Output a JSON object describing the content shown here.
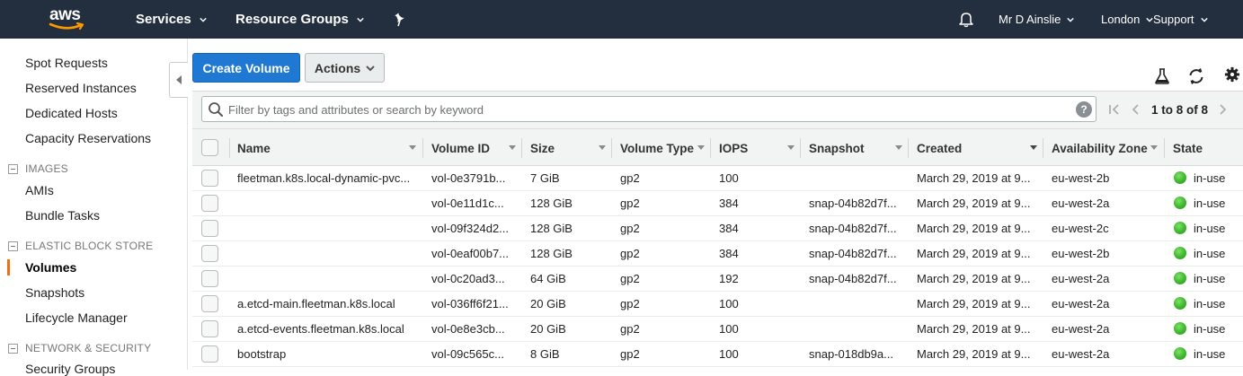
{
  "nav": {
    "logo": "aws",
    "services": "Services",
    "resource_groups": "Resource Groups",
    "pin_icon": "pin-icon",
    "bell_icon": "bell-icon",
    "user": "Mr D Ainslie",
    "region": "London",
    "support": "Support"
  },
  "sidebar": {
    "items_top": [
      {
        "label": "Spot Requests"
      },
      {
        "label": "Reserved Instances"
      },
      {
        "label": "Dedicated Hosts"
      },
      {
        "label": "Capacity Reservations"
      }
    ],
    "sections": [
      {
        "title": "IMAGES",
        "items": [
          {
            "label": "AMIs"
          },
          {
            "label": "Bundle Tasks"
          }
        ]
      },
      {
        "title": "ELASTIC BLOCK STORE",
        "items": [
          {
            "label": "Volumes",
            "active": true
          },
          {
            "label": "Snapshots"
          },
          {
            "label": "Lifecycle Manager"
          }
        ]
      },
      {
        "title": "NETWORK & SECURITY",
        "items": [
          {
            "label": "Security Groups"
          }
        ]
      }
    ]
  },
  "toolbar": {
    "create_label": "Create Volume",
    "actions_label": "Actions"
  },
  "filter": {
    "placeholder": "Filter by tags and attributes or search by keyword",
    "help": "?",
    "pagination": "1 to 8 of 8"
  },
  "table": {
    "columns": [
      "Name",
      "Volume ID",
      "Size",
      "Volume Type",
      "IOPS",
      "Snapshot",
      "Created",
      "Availability Zone",
      "State"
    ],
    "rows": [
      {
        "name": "fleetman.k8s.local-dynamic-pvc...",
        "volume_id": "vol-0e3791b...",
        "size": "7 GiB",
        "type": "gp2",
        "iops": "100",
        "snapshot": "",
        "created": "March 29, 2019 at 9...",
        "az": "eu-west-2b",
        "state": "in-use"
      },
      {
        "name": "",
        "volume_id": "vol-0e11d1c...",
        "size": "128 GiB",
        "type": "gp2",
        "iops": "384",
        "snapshot": "snap-04b82d7f...",
        "created": "March 29, 2019 at 9...",
        "az": "eu-west-2a",
        "state": "in-use"
      },
      {
        "name": "",
        "volume_id": "vol-09f324d2...",
        "size": "128 GiB",
        "type": "gp2",
        "iops": "384",
        "snapshot": "snap-04b82d7f...",
        "created": "March 29, 2019 at 9...",
        "az": "eu-west-2c",
        "state": "in-use"
      },
      {
        "name": "",
        "volume_id": "vol-0eaf00b7...",
        "size": "128 GiB",
        "type": "gp2",
        "iops": "384",
        "snapshot": "snap-04b82d7f...",
        "created": "March 29, 2019 at 9...",
        "az": "eu-west-2b",
        "state": "in-use"
      },
      {
        "name": "",
        "volume_id": "vol-0c20ad3...",
        "size": "64 GiB",
        "type": "gp2",
        "iops": "192",
        "snapshot": "snap-04b82d7f...",
        "created": "March 29, 2019 at 9...",
        "az": "eu-west-2a",
        "state": "in-use"
      },
      {
        "name": "a.etcd-main.fleetman.k8s.local",
        "volume_id": "vol-036ff6f21...",
        "size": "20 GiB",
        "type": "gp2",
        "iops": "100",
        "snapshot": "",
        "created": "March 29, 2019 at 9...",
        "az": "eu-west-2a",
        "state": "in-use"
      },
      {
        "name": "a.etcd-events.fleetman.k8s.local",
        "volume_id": "vol-0e8e3cb...",
        "size": "20 GiB",
        "type": "gp2",
        "iops": "100",
        "snapshot": "",
        "created": "March 29, 2019 at 9...",
        "az": "eu-west-2a",
        "state": "in-use"
      },
      {
        "name": "bootstrap",
        "volume_id": "vol-09c565c...",
        "size": "8 GiB",
        "type": "gp2",
        "iops": "100",
        "snapshot": "snap-018db9a...",
        "created": "March 29, 2019 at 9...",
        "az": "eu-west-2a",
        "state": "in-use"
      }
    ]
  },
  "colors": {
    "nav_bg": "#232f3e",
    "primary": "#1f79d3",
    "active_indicator": "#ec7211",
    "status_ok": "#3cb62c"
  }
}
